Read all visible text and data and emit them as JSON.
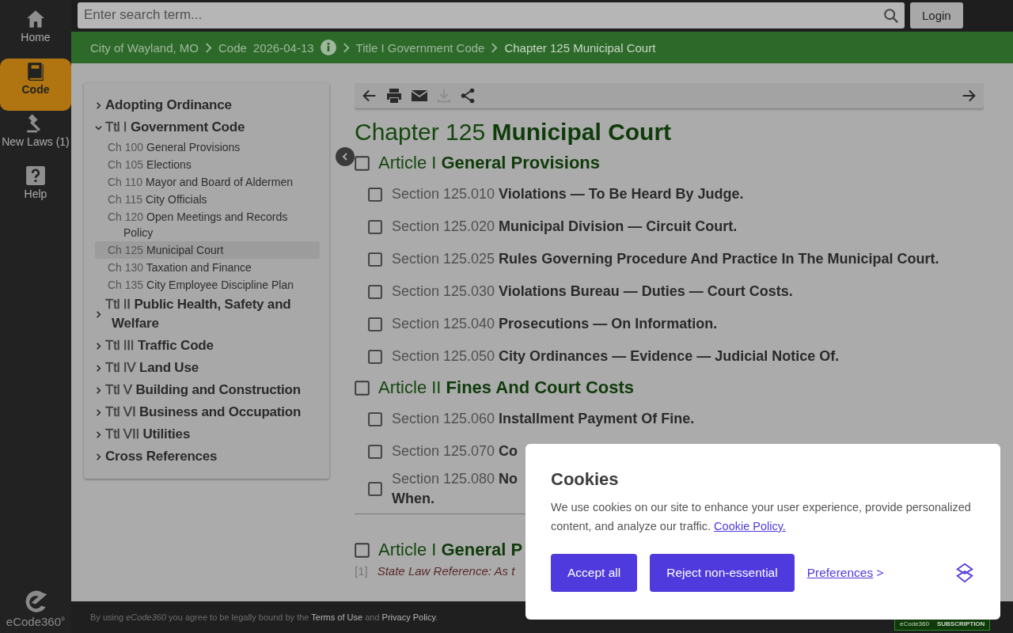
{
  "nav": [
    {
      "label": "Home",
      "selected": false
    },
    {
      "label": "Code",
      "selected": true
    },
    {
      "label": "New Laws (1)",
      "selected": false
    },
    {
      "label": "Help",
      "selected": false
    }
  ],
  "logo": "eCode360$^{®}$",
  "search": {
    "placeholder": "Enter search term..."
  },
  "login": "Login",
  "breadcrumbs": [
    {
      "label": "City of Wayland, MO",
      "current": false
    },
    {
      "label": "Code",
      "date": "2026-04-13",
      "current": false
    },
    {
      "label": "Title I Government Code",
      "current": false
    },
    {
      "label": "Chapter 125 Municipal Court",
      "current": true
    }
  ],
  "toc": [
    {
      "title": "Adopting Ordinance",
      "expanded": false
    },
    {
      "prefix": "Ttl I",
      "title": "Government Code",
      "expanded": true,
      "children": [
        {
          "prefix": "Ch 100",
          "title": "General Provisions",
          "selected": false
        },
        {
          "prefix": "Ch 105",
          "title": "Elections",
          "selected": false
        },
        {
          "prefix": "Ch 110",
          "title": "Mayor and Board of Aldermen",
          "selected": false
        },
        {
          "prefix": "Ch 115",
          "title": "City Officials",
          "selected": false
        },
        {
          "prefix": "Ch 120",
          "title": "Open Meetings and Records Policy",
          "selected": false
        },
        {
          "prefix": "Ch 125",
          "title": "Municipal Court",
          "selected": true
        },
        {
          "prefix": "Ch 130",
          "title": "Taxation and Finance",
          "selected": false
        },
        {
          "prefix": "Ch 135",
          "title": "City Employee Discipline Plan",
          "selected": false
        }
      ]
    },
    {
      "prefix": "Ttl II",
      "title": "Public Health, Safety and Welfare",
      "expanded": false
    },
    {
      "prefix": "Ttl III",
      "title": "Traffic Code",
      "expanded": false
    },
    {
      "prefix": "Ttl IV",
      "title": "Land Use",
      "expanded": false
    },
    {
      "prefix": "Ttl V",
      "title": "Building and Construction",
      "expanded": false
    },
    {
      "prefix": "Ttl VI",
      "title": "Business and Occupation",
      "expanded": false
    },
    {
      "prefix": "Ttl VII",
      "title": "Utilities",
      "expanded": false
    },
    {
      "title": "Cross References",
      "expanded": false
    }
  ],
  "toolbar": {
    "download_disabled": true
  },
  "chapter": {
    "number": "Chapter 125",
    "title": "Municipal Court"
  },
  "articles": [
    {
      "number": "Article I",
      "title": "General Provisions",
      "checked": false,
      "sections": [
        {
          "number": "Section 125.010",
          "title": "Violations — To Be Heard By Judge.",
          "checked": false
        },
        {
          "number": "Section 125.020",
          "title": "Municipal Division — Circuit Court.",
          "checked": false
        },
        {
          "number": "Section 125.025",
          "title": "Rules Governing Procedure And Practice In The Municipal Court.",
          "checked": false
        },
        {
          "number": "Section 125.030",
          "title": "Violations Bureau — Duties — Court Costs.",
          "checked": false
        },
        {
          "number": "Section 125.040",
          "title": "Prosecutions — On Information.",
          "checked": false
        },
        {
          "number": "Section 125.050",
          "title": "City Ordinances — Evidence — Judicial Notice Of.",
          "checked": false
        }
      ]
    },
    {
      "number": "Article II",
      "title": "Fines And Court Costs",
      "checked": false,
      "sections": [
        {
          "number": "Section 125.060",
          "title": "Installment Payment Of Fine.",
          "checked": false
        },
        {
          "number": "Section 125.070",
          "title": "Co",
          "checked": false
        },
        {
          "number": "Section 125.080",
          "title": "No",
          "title_line2": "When.",
          "checked": false
        }
      ]
    }
  ],
  "body": {
    "article": {
      "number": "Article I",
      "title": "General P",
      "checked": false
    },
    "footnote": {
      "mark": "[1]",
      "text": "State Law Reference: As t"
    }
  },
  "footer": {
    "before": "By using *eCode360* you agree to be legally bound by the ",
    "terms": "Terms of Use",
    "between": " and ",
    "privacy": "Privacy Policy",
    "after": "."
  },
  "badge": {
    "brand": "eCode360",
    "label": "SUBSCRIPTION"
  },
  "cookies": {
    "title": "Cookies",
    "text": "We use cookies on our site to enhance your user experience, provide personalized content, and analyze our traffic.",
    "link": "Cookie Policy.",
    "buttons": [
      "Accept all",
      "Reject non-essential"
    ],
    "preferences": "Preferences",
    "preferences_arrow": ">"
  }
}
